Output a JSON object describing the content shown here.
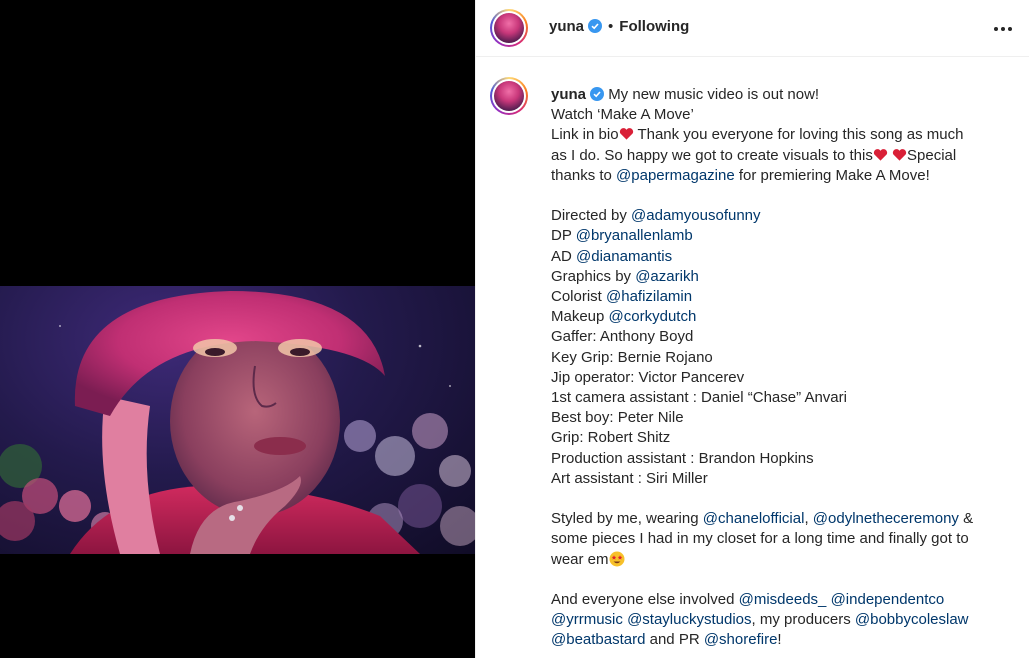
{
  "post": {
    "username": "yuna",
    "follow_status": "Following",
    "separator": "•",
    "icons": {
      "verified": "verified-badge-icon",
      "more": "more-options-icon",
      "heart": "red-heart-emoji",
      "star_eyes": "star-struck-emoji"
    },
    "colors": {
      "mention": "#00376b",
      "verified": "#3897f0",
      "text": "#262626"
    }
  },
  "caption": {
    "l1": "My new music video is out now!",
    "l2": "Watch ‘Make A Move’",
    "l3a": "Link in bio",
    "l3b": " Thank you everyone for loving this song as much",
    "l4a": "as I do. So happy we got to create visuals to this",
    "l4b": "Special",
    "l5a": "thanks to ",
    "l5m": "@papermagazine",
    "l5b": " for premiering Make A Move!",
    "credits": [
      {
        "role": "Directed by ",
        "mention": "@adamyousofunny"
      },
      {
        "role": "DP ",
        "mention": "@bryanallenlamb"
      },
      {
        "role": "AD ",
        "mention": "@dianamantis"
      },
      {
        "role": "Graphics by ",
        "mention": "@azarikh"
      },
      {
        "role": "Colorist ",
        "mention": "@hafizilamin"
      },
      {
        "role": "Makeup ",
        "mention": "@corkydutch"
      }
    ],
    "crew": [
      "Gaffer: Anthony Boyd",
      "Key Grip: Bernie Rojano",
      "Jip operator: Victor Pancerev",
      "1st camera assistant : Daniel “Chase” Anvari",
      "Best boy: Peter Nile",
      "Grip: Robert Shitz",
      "Production assistant : Brandon Hopkins",
      "Art assistant : Siri Miller"
    ],
    "styled_a": "Styled by me, wearing ",
    "styled_m1": "@chanelofficial",
    "styled_b": ", ",
    "styled_m2": "@odylnetheceremony",
    "styled_c": " &",
    "styled_l2": "some pieces I had in my closet for a long time and finally got to",
    "styled_l3": "wear em",
    "and_a": "And everyone else involved ",
    "and_m1": "@misdeeds_",
    "and_m2": "@independentco",
    "and2_m1": "@yrrmusic",
    "and2_m2": "@stayluckystudios",
    "and2_b": ", my producers ",
    "and2_m3": "@bobbycoleslaw",
    "and3_m1": "@beatbastard",
    "and3_b": " and PR ",
    "and3_m2": "@shorefire",
    "and3_c": "!"
  }
}
